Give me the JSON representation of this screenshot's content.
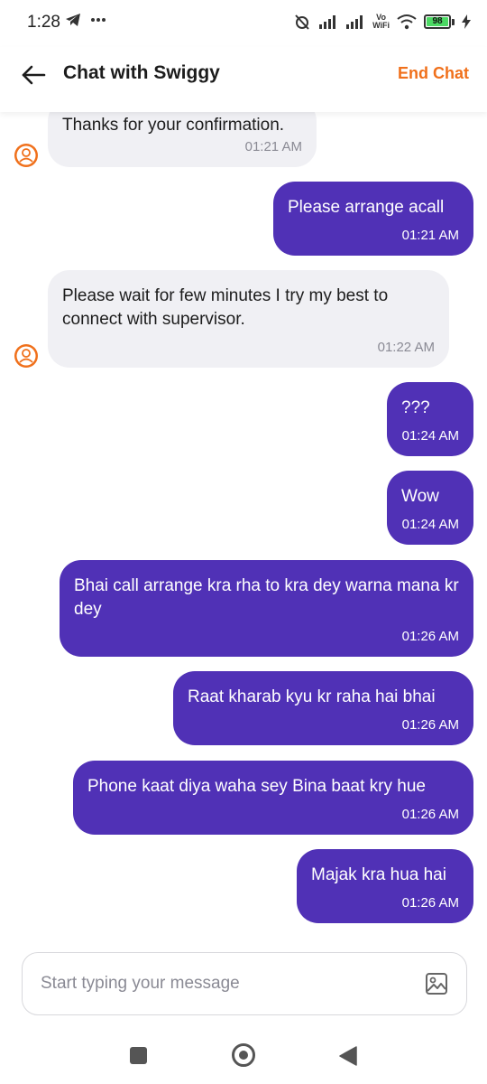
{
  "status_bar": {
    "time": "1:28",
    "battery": "98",
    "volte_top": "Vo",
    "volte_bottom": "WiFi"
  },
  "header": {
    "title": "Chat with Swiggy",
    "end_chat_label": "End Chat",
    "back_icon": "arrow-left-icon"
  },
  "messages": [
    {
      "sender": "agent",
      "text": "Thanks for your confirmation.",
      "time": "01:21 AM"
    },
    {
      "sender": "user",
      "text": "Please arrange acall",
      "time": "01:21 AM"
    },
    {
      "sender": "agent",
      "text": "Please wait for few minutes I try my best to connect with supervisor.",
      "time": "01:22 AM"
    },
    {
      "sender": "user",
      "text": "???",
      "time": "01:24 AM"
    },
    {
      "sender": "user",
      "text": "Wow",
      "time": "01:24 AM"
    },
    {
      "sender": "user",
      "text": "Bhai call arrange kra rha to kra dey warna mana kr dey",
      "time": "01:26 AM"
    },
    {
      "sender": "user",
      "text": "Raat kharab kyu kr raha hai bhai",
      "time": "01:26 AM"
    },
    {
      "sender": "user",
      "text": "Phone kaat diya waha sey Bina baat kry hue",
      "time": "01:26 AM"
    },
    {
      "sender": "user",
      "text": "Majak kra hua hai",
      "time": "01:26 AM"
    }
  ],
  "composer": {
    "placeholder": "Start typing your message",
    "value": ""
  },
  "colors": {
    "accent": "#f0701b",
    "user_bubble": "#5031b6",
    "agent_bubble": "#f0f0f4"
  }
}
